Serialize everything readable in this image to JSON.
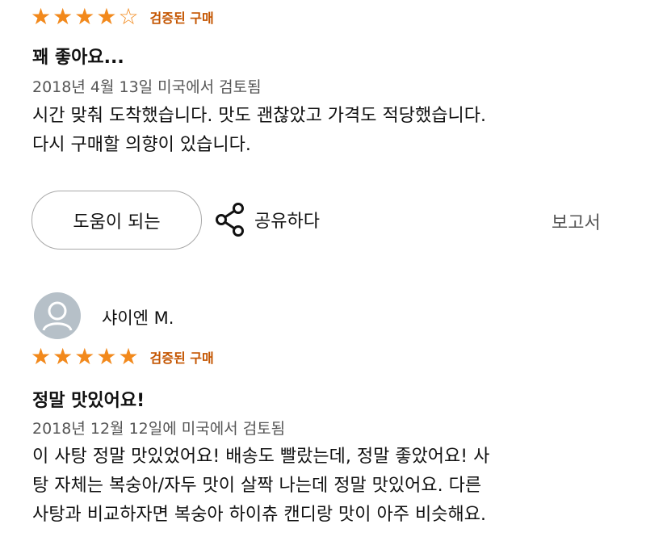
{
  "colors": {
    "star": "#f2891c",
    "verified": "#c45500",
    "date": "#555555",
    "border": "#a8a8a8"
  },
  "review1": {
    "rating": 4,
    "max_rating": 5,
    "verified": "검증된 구매",
    "title": "꽤 좋아요...",
    "date": "2018년 4월 13일 미국에서 검토됨",
    "body_lines": [
      "시간 맞춰 도착했습니다. 맛도 괜찮았고 가격도 적당했습니다.",
      "다시 구매할 의향이 있습니다."
    ],
    "helpful_label": "도움이 되는",
    "share_label": "공유하다",
    "report_label": "보고서"
  },
  "review2": {
    "reviewer": "샤이엔 M.",
    "rating": 5,
    "max_rating": 5,
    "verified": "검증된 구매",
    "title": "정말 맛있어요!",
    "date": "2018년 12월 12일에 미국에서 검토됨",
    "body_lines": [
      "이 사탕 정말 맛있었어요! 배송도 빨랐는데, 정말 좋았어요! 사",
      "탕 자체는 복숭아/자두 맛이 살짝 나는데 정말 맛있어요. 다른",
      "사탕과 비교하자면 복숭아 하이츄 캔디랑 맛이 아주 비슷해요."
    ]
  }
}
